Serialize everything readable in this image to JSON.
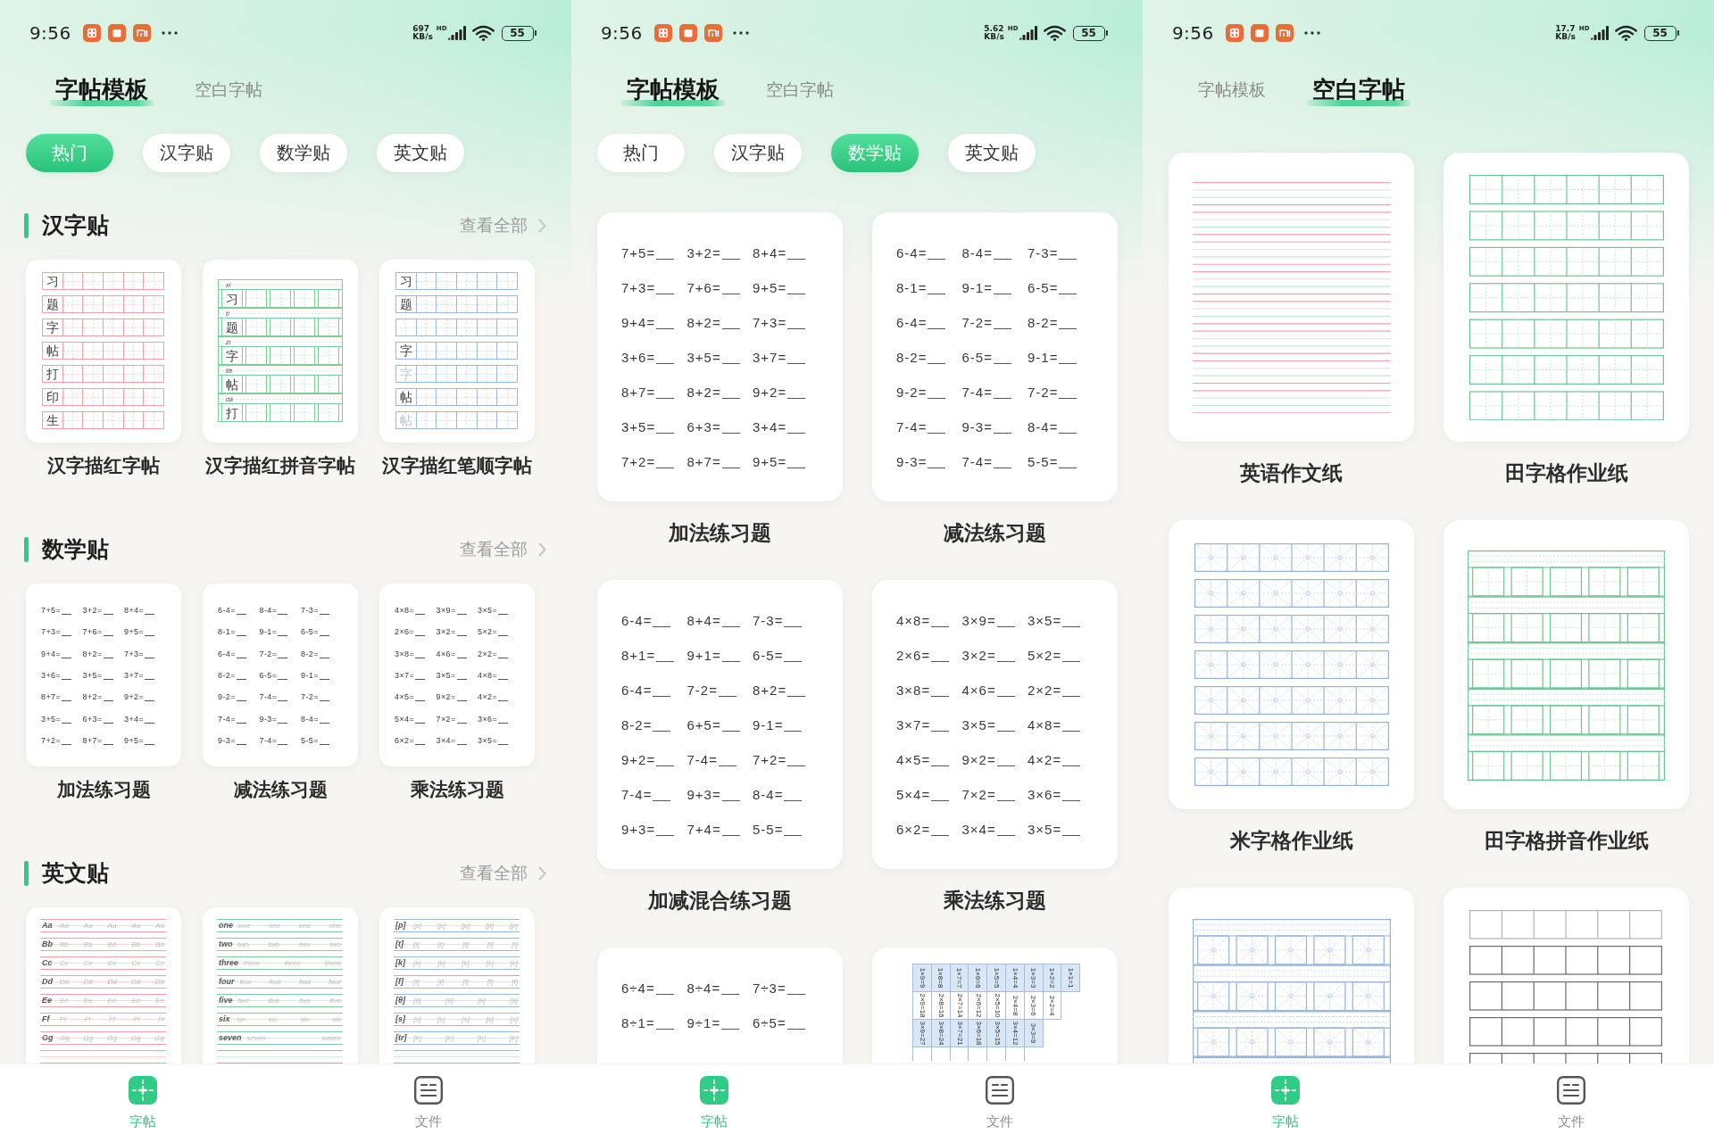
{
  "screens": [
    {
      "status_bar": {
        "time": "9:56",
        "speed": "697",
        "speed_unit": "KB/s",
        "network": "HD",
        "battery": "55"
      },
      "top_tabs": [
        {
          "label": "字帖模板",
          "selected": true
        },
        {
          "label": "空白字帖",
          "selected": false
        }
      ],
      "chips": [
        {
          "label": "热门",
          "selected": true
        },
        {
          "label": "汉字贴",
          "selected": false
        },
        {
          "label": "数学贴",
          "selected": false
        },
        {
          "label": "英文贴",
          "selected": false
        }
      ],
      "sections": [
        {
          "title": "汉字贴",
          "more": "查看全部",
          "cards": [
            {
              "title": "汉字描红字帖",
              "sheet": {
                "kind": "hanzi",
                "chars": [
                  "习",
                  "题",
                  "字",
                  "帖",
                  "打",
                  "印",
                  "生"
                ]
              }
            },
            {
              "title": "汉字描红拼音字帖",
              "sheet": {
                "kind": "pinyin",
                "rows": [
                  {
                    "pinyin": "xí",
                    "char": "习"
                  },
                  {
                    "pinyin": "tí",
                    "char": "题"
                  },
                  {
                    "pinyin": "zì",
                    "char": "字"
                  },
                  {
                    "pinyin": "tiè",
                    "char": "帖"
                  },
                  {
                    "pinyin": "dǎ",
                    "char": "打"
                  }
                ]
              }
            },
            {
              "title": "汉字描红笔顺字帖",
              "sheet": {
                "kind": "stroke",
                "rows": [
                  {
                    "kind": "lead",
                    "char": "习"
                  },
                  {
                    "kind": "lead",
                    "char": "题"
                  },
                  {
                    "kind": "blank"
                  },
                  {
                    "kind": "lead",
                    "char": "字"
                  },
                  {
                    "kind": "faded",
                    "char": "字"
                  },
                  {
                    "kind": "lead",
                    "char": "帖"
                  },
                  {
                    "kind": "faded",
                    "char": "帖"
                  }
                ]
              }
            }
          ]
        },
        {
          "title": "数学贴",
          "more": "查看全部",
          "cards": [
            {
              "title": "加法练习题",
              "sheet": {
                "kind": "math",
                "rows": [
                  [
                    "7+5=",
                    "3+2=",
                    "8+4="
                  ],
                  [
                    "7+3=",
                    "7+6=",
                    "9+5="
                  ],
                  [
                    "9+4=",
                    "8+2=",
                    "7+3="
                  ],
                  [
                    "3+6=",
                    "3+5=",
                    "3+7="
                  ],
                  [
                    "8+7=",
                    "8+2=",
                    "9+2="
                  ],
                  [
                    "3+5=",
                    "6+3=",
                    "3+4="
                  ],
                  [
                    "7+2=",
                    "8+7=",
                    "9+5="
                  ]
                ]
              }
            },
            {
              "title": "减法练习题",
              "sheet": {
                "kind": "math",
                "rows": [
                  [
                    "6-4=",
                    "8-4=",
                    "7-3="
                  ],
                  [
                    "8-1=",
                    "9-1=",
                    "6-5="
                  ],
                  [
                    "6-4=",
                    "7-2=",
                    "8-2="
                  ],
                  [
                    "8-2=",
                    "6-5=",
                    "9-1="
                  ],
                  [
                    "9-2=",
                    "7-4=",
                    "7-2="
                  ],
                  [
                    "7-4=",
                    "9-3=",
                    "8-4="
                  ],
                  [
                    "9-3=",
                    "7-4=",
                    "5-5="
                  ]
                ]
              }
            },
            {
              "title": "乘法练习题",
              "sheet": {
                "kind": "math",
                "rows": [
                  [
                    "4×8=",
                    "3×9=",
                    "3×5="
                  ],
                  [
                    "2×6=",
                    "3×2=",
                    "5×2="
                  ],
                  [
                    "3×8=",
                    "4×6=",
                    "2×2="
                  ],
                  [
                    "3×7=",
                    "3×5=",
                    "4×8="
                  ],
                  [
                    "4×5=",
                    "9×2=",
                    "4×2="
                  ],
                  [
                    "5×4=",
                    "7×2=",
                    "3×6="
                  ],
                  [
                    "6×2=",
                    "3×4=",
                    "3×5="
                  ]
                ]
              }
            }
          ]
        },
        {
          "title": "英文贴",
          "more": "查看全部",
          "cards": [
            {
              "sheet": {
                "kind": "letters",
                "rows": [
                  {
                    "lead": "Aa",
                    "trace": "Aa Aa Aa Aa Aa"
                  },
                  {
                    "lead": "Bb",
                    "trace": "Bb Bb Bb Bb Bb"
                  },
                  {
                    "lead": "Cc",
                    "trace": "Cc Cc Cc Cc Cc"
                  },
                  {
                    "lead": "Dd",
                    "trace": "Dd Dd Dd Dd Dd"
                  },
                  {
                    "lead": "Ee",
                    "trace": "Ee Ee Ee Ee Ee"
                  },
                  {
                    "lead": "Ff",
                    "trace": "Ff Ff Ff Ff Ff"
                  },
                  {
                    "lead": "Gg",
                    "trace": "Gg Gg Gg Gg Gg"
                  }
                ]
              }
            },
            {
              "sheet": {
                "kind": "words",
                "rows": [
                  {
                    "lead": "one",
                    "trace": "one one one one"
                  },
                  {
                    "lead": "two",
                    "trace": "two two two two"
                  },
                  {
                    "lead": "three",
                    "trace": "three three three"
                  },
                  {
                    "lead": "four",
                    "trace": "four four four four"
                  },
                  {
                    "lead": "five",
                    "trace": "five five five five"
                  },
                  {
                    "lead": "six",
                    "trace": "six six six six"
                  },
                  {
                    "lead": "seven",
                    "trace": "seven seven"
                  }
                ]
              }
            },
            {
              "sheet": {
                "kind": "phonetic",
                "rows": [
                  {
                    "lead": "[p]",
                    "trace": "[p] [p] [p] [p] [p]"
                  },
                  {
                    "lead": "[t]",
                    "trace": "[t] [t] [t] [t] [t]"
                  },
                  {
                    "lead": "[k]",
                    "trace": "[k] [k] [k] [k] [k]"
                  },
                  {
                    "lead": "[f]",
                    "trace": "[f] [f] [f] [f] [f]"
                  },
                  {
                    "lead": "[θ]",
                    "trace": "[θ] [θ] [θ] [θ]"
                  },
                  {
                    "lead": "[s]",
                    "trace": "[s] [s] [s] [s] [s]"
                  },
                  {
                    "lead": "[tr]",
                    "trace": "[tr] [tr] [tr] [tr]"
                  }
                ]
              }
            }
          ]
        }
      ],
      "bottom_nav": [
        {
          "label": "字帖",
          "selected": true
        },
        {
          "label": "文件",
          "selected": false
        }
      ]
    },
    {
      "status_bar": {
        "time": "9:56",
        "speed": "5.62",
        "speed_unit": "KB/s",
        "network": "HD",
        "battery": "55"
      },
      "top_tabs": [
        {
          "label": "字帖模板",
          "selected": true
        },
        {
          "label": "空白字帖",
          "selected": false
        }
      ],
      "chips": [
        {
          "label": "热门",
          "selected": false
        },
        {
          "label": "汉字贴",
          "selected": false
        },
        {
          "label": "数学贴",
          "selected": true
        },
        {
          "label": "英文贴",
          "selected": false
        }
      ],
      "cards": [
        {
          "title": "加法练习题",
          "sheet": {
            "kind": "math",
            "rows": [
              [
                "7+5=",
                "3+2=",
                "8+4="
              ],
              [
                "7+3=",
                "7+6=",
                "9+5="
              ],
              [
                "9+4=",
                "8+2=",
                "7+3="
              ],
              [
                "3+6=",
                "3+5=",
                "3+7="
              ],
              [
                "8+7=",
                "8+2=",
                "9+2="
              ],
              [
                "3+5=",
                "6+3=",
                "3+4="
              ],
              [
                "7+2=",
                "8+7=",
                "9+5="
              ]
            ]
          }
        },
        {
          "title": "减法练习题",
          "sheet": {
            "kind": "math",
            "rows": [
              [
                "6-4=",
                "8-4=",
                "7-3="
              ],
              [
                "8-1=",
                "9-1=",
                "6-5="
              ],
              [
                "6-4=",
                "7-2=",
                "8-2="
              ],
              [
                "8-2=",
                "6-5=",
                "9-1="
              ],
              [
                "9-2=",
                "7-4=",
                "7-2="
              ],
              [
                "7-4=",
                "9-3=",
                "8-4="
              ],
              [
                "9-3=",
                "7-4=",
                "5-5="
              ]
            ]
          }
        },
        {
          "title": "加减混合练习题",
          "sheet": {
            "kind": "math",
            "rows": [
              [
                "6-4=",
                "8+4=",
                "7-3="
              ],
              [
                "8+1=",
                "9+1=",
                "6-5="
              ],
              [
                "6-4=",
                "7-2=",
                "8+2="
              ],
              [
                "8-2=",
                "6+5=",
                "9-1="
              ],
              [
                "9+2=",
                "7-4=",
                "7+2="
              ],
              [
                "7-4=",
                "9+3=",
                "8-4="
              ],
              [
                "9+3=",
                "7+4=",
                "5-5="
              ]
            ]
          }
        },
        {
          "title": "乘法练习题",
          "sheet": {
            "kind": "math",
            "rows": [
              [
                "4×8=",
                "3×9=",
                "3×5="
              ],
              [
                "2×6=",
                "3×2=",
                "5×2="
              ],
              [
                "3×8=",
                "4×6=",
                "2×2="
              ],
              [
                "3×7=",
                "3×5=",
                "4×8="
              ],
              [
                "4×5=",
                "9×2=",
                "4×2="
              ],
              [
                "5×4=",
                "7×2=",
                "3×6="
              ],
              [
                "6×2=",
                "3×4=",
                "3×5="
              ]
            ]
          }
        },
        {
          "sheet": {
            "kind": "math",
            "rows": [
              [
                "6÷4=",
                "8÷4=",
                "7÷3="
              ],
              [
                "8÷1=",
                "9÷1=",
                "6÷5="
              ]
            ]
          }
        },
        {
          "sheet": {
            "kind": "times_table",
            "rows": [
              [
                "1×9=9",
                "1×8=8",
                "1×7=7",
                "1×6=6",
                "1×5=5",
                "1×4=4",
                "1×3=3",
                "1×2=2",
                "1×1=1"
              ],
              [
                "2×9=18",
                "2×8=16",
                "2×7=14",
                "2×6=12",
                "2×5=10",
                "2×4=8",
                "2×3=6",
                "2×2=4"
              ],
              [
                "3×9=27",
                "3×8=24",
                "3×7=21",
                "3×6=18",
                "3×5=15",
                "3×4=12",
                "3×3=9"
              ]
            ]
          }
        }
      ],
      "bottom_nav": [
        {
          "label": "字帖",
          "selected": true
        },
        {
          "label": "文件",
          "selected": false
        }
      ]
    },
    {
      "status_bar": {
        "time": "9:56",
        "speed": "17.7",
        "speed_unit": "KB/s",
        "network": "HD",
        "battery": "55"
      },
      "top_tabs": [
        {
          "label": "字帖模板",
          "selected": false
        },
        {
          "label": "空白字帖",
          "selected": true
        }
      ],
      "cards": [
        {
          "title": "英语作文纸",
          "sheet": {
            "kind": "lined"
          }
        },
        {
          "title": "田字格作业纸",
          "sheet": {
            "kind": "tian"
          }
        },
        {
          "title": "米字格作业纸",
          "sheet": {
            "kind": "mi"
          }
        },
        {
          "title": "田字格拼音作业纸",
          "sheet": {
            "kind": "tian_pinyin"
          }
        },
        {
          "sheet": {
            "kind": "mi_pinyin"
          }
        },
        {
          "sheet": {
            "kind": "square"
          }
        }
      ],
      "bottom_nav": [
        {
          "label": "字帖",
          "selected": true
        },
        {
          "label": "文件",
          "selected": false
        }
      ]
    }
  ]
}
